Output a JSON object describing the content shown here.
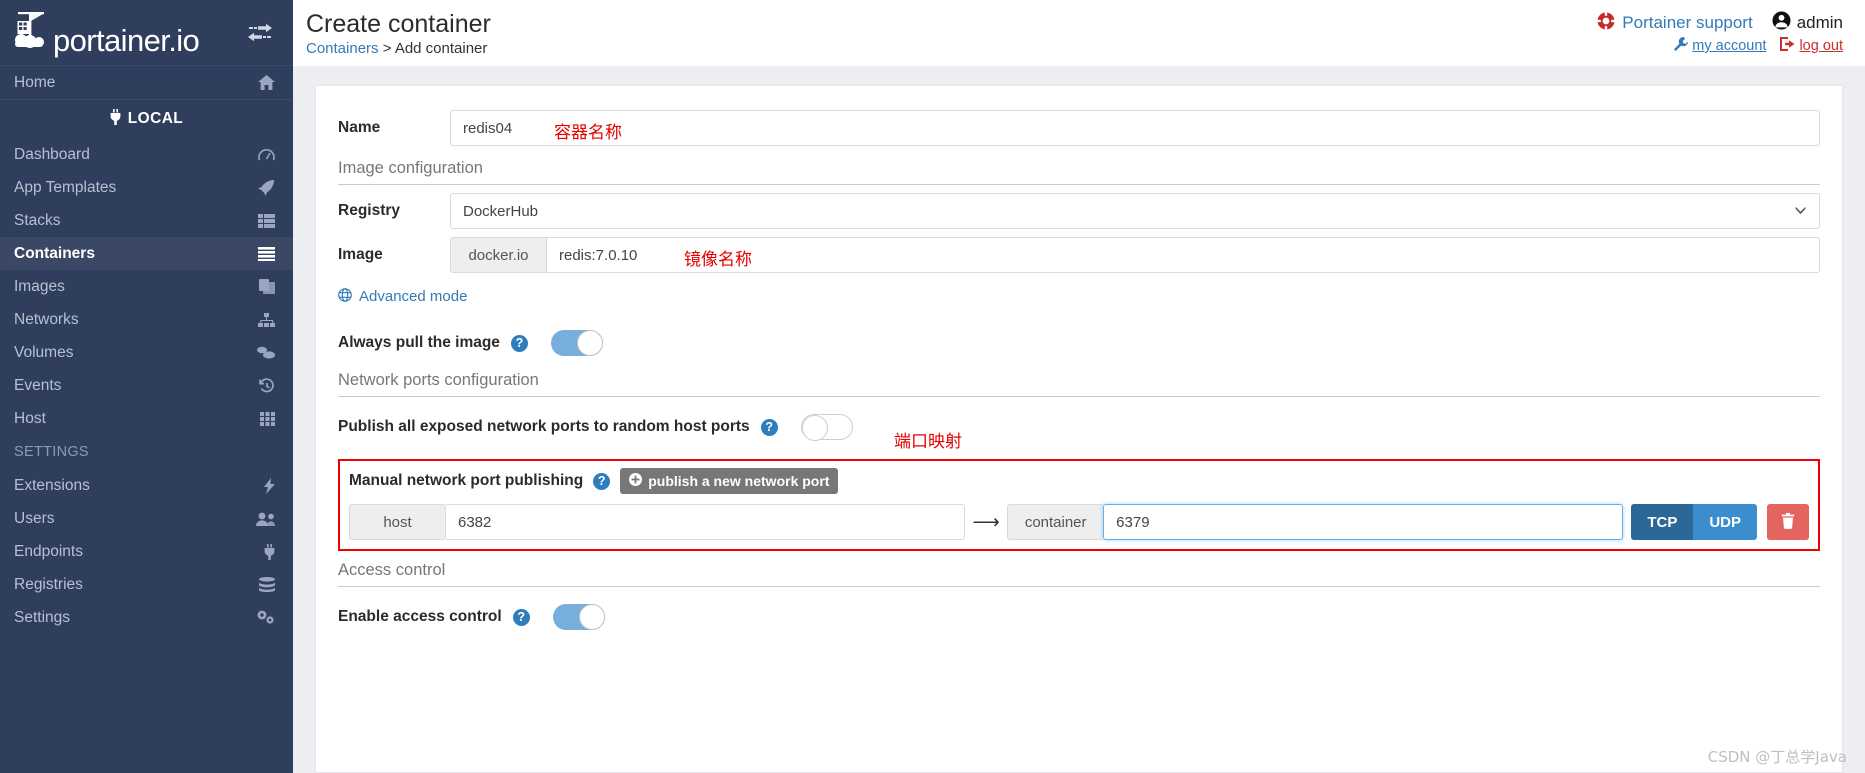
{
  "sidebar": {
    "brand": "portainer.io",
    "toggle_icon": "collapse-arrows-icon",
    "home": {
      "label": "Home",
      "icon": "home-icon"
    },
    "endpoint": {
      "label": "LOCAL",
      "icon": "plug-icon"
    },
    "items": [
      {
        "label": "Dashboard",
        "icon": "dashboard-icon",
        "active": false
      },
      {
        "label": "App Templates",
        "icon": "rocket-icon",
        "active": false
      },
      {
        "label": "Stacks",
        "icon": "stacks-icon",
        "active": false
      },
      {
        "label": "Containers",
        "icon": "containers-icon",
        "active": true
      },
      {
        "label": "Images",
        "icon": "images-icon",
        "active": false
      },
      {
        "label": "Networks",
        "icon": "networks-icon",
        "active": false
      },
      {
        "label": "Volumes",
        "icon": "volumes-icon",
        "active": false
      },
      {
        "label": "Events",
        "icon": "history-icon",
        "active": false
      },
      {
        "label": "Host",
        "icon": "host-grid-icon",
        "active": false
      }
    ],
    "settings_section": "SETTINGS",
    "settings_items": [
      {
        "label": "Extensions",
        "icon": "bolt-icon"
      },
      {
        "label": "Users",
        "icon": "users-icon"
      },
      {
        "label": "Endpoints",
        "icon": "plug-icon"
      },
      {
        "label": "Registries",
        "icon": "registries-icon"
      },
      {
        "label": "Settings",
        "icon": "gear-icon"
      }
    ]
  },
  "header": {
    "title": "Create container",
    "breadcrumb_root": "Containers",
    "breadcrumb_sep": ">",
    "breadcrumb_current": "Add container",
    "support_label": "Portainer support",
    "support_icon": "lifebuoy-icon",
    "user_name": "admin",
    "user_icon": "user-circle-icon",
    "my_account_label": "my account",
    "my_account_icon": "wrench-icon",
    "log_out_label": "log out",
    "log_out_icon": "logout-icon"
  },
  "form": {
    "name": {
      "label": "Name",
      "value": "redis04",
      "placeholder": "e.g. myContainer",
      "annotation": "容器名称"
    },
    "image_config_section": "Image configuration",
    "registry": {
      "label": "Registry",
      "selected": "DockerHub",
      "options": [
        "DockerHub"
      ],
      "chevron_icon": "chevron-down-icon"
    },
    "image": {
      "label": "Image",
      "addon": "docker.io",
      "value": "redis:7.0.10",
      "placeholder": "e.g. nginx:latest",
      "annotation": "镜像名称"
    },
    "advanced_mode": {
      "label": "Advanced mode",
      "icon": "globe-icon"
    },
    "always_pull": {
      "label": "Always pull the image",
      "help_icon": "question-help-icon",
      "state": "on"
    },
    "network_ports_section": "Network ports configuration",
    "publish_all": {
      "label": "Publish all exposed network ports to random host ports",
      "help_icon": "question-help-icon",
      "state": "off"
    },
    "port_mapping_annotation": "端口映射",
    "manual_publishing": {
      "label": "Manual network port publishing",
      "help_icon": "question-help-icon",
      "add_button": "publish a new network port",
      "add_button_icon": "plus-circle-icon",
      "rows": [
        {
          "host_addon": "host",
          "host_value": "6382",
          "host_placeholder": "e.g. 80",
          "arrow_icon": "arrow-right-icon",
          "container_addon": "container",
          "container_value": "6379",
          "container_placeholder": "e.g. 80",
          "container_focused": true,
          "tcp_label": "TCP",
          "udp_label": "UDP",
          "protocol_selected": "TCP",
          "delete_icon": "trash-icon"
        }
      ]
    },
    "access_control_section": "Access control",
    "enable_access_control": {
      "label": "Enable access control",
      "help_icon": "question-help-icon",
      "state": "on"
    }
  },
  "watermark": "CSDN @丁总学Java",
  "colors": {
    "sidebar_bg": "#2f3e5d",
    "accent_blue": "#337ab7",
    "annotation_red": "#e60000",
    "toggle_on": "#77aedb",
    "tcp": "#2b6898",
    "udp": "#3c8dcd",
    "delete": "#e4655f",
    "logout_red": "#c9302c"
  }
}
